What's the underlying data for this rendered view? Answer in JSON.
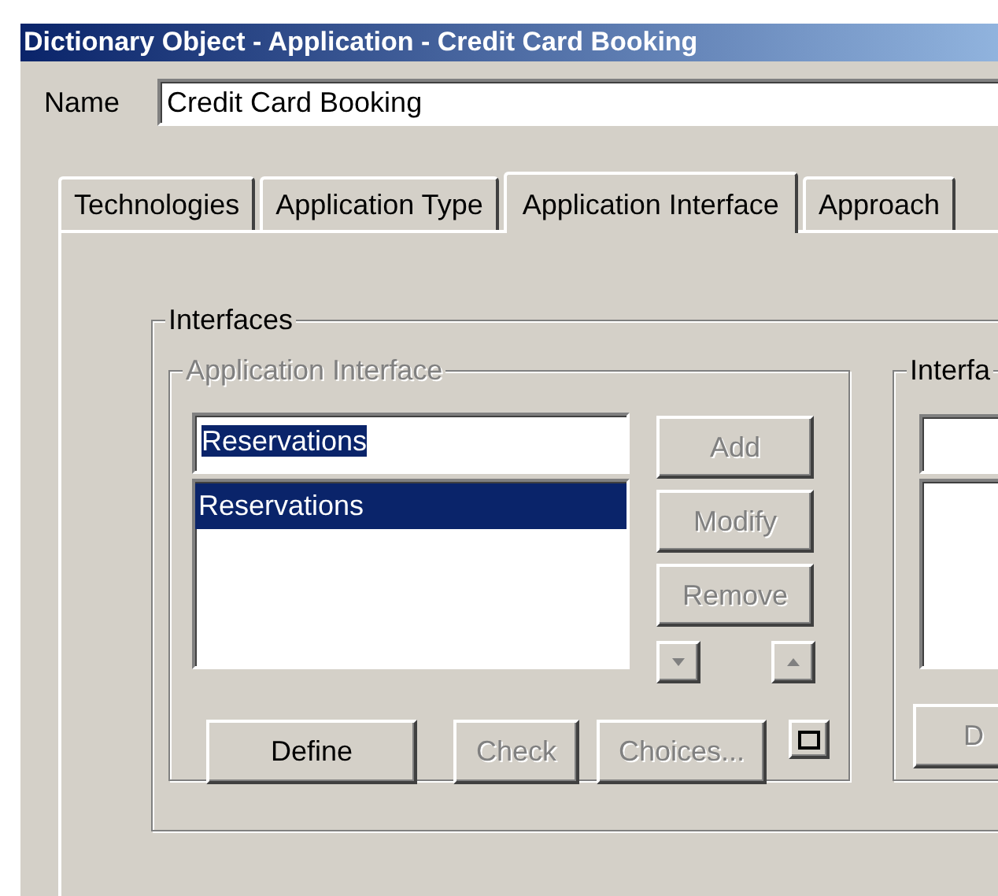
{
  "window": {
    "title": "Dictionary Object - Application - Credit Card Booking"
  },
  "name_field": {
    "label": "Name",
    "value": "Credit Card Booking"
  },
  "tabs": [
    {
      "label": "Technologies",
      "selected": false
    },
    {
      "label": "Application Type",
      "selected": false
    },
    {
      "label": "Application Interface",
      "selected": true
    },
    {
      "label": "Approach",
      "selected": false
    }
  ],
  "interfaces": {
    "title": "Interfaces",
    "application_interface": {
      "title": "Application Interface",
      "disabled": true,
      "input": {
        "value": "Reservations",
        "text_selected": true
      },
      "list": [
        {
          "label": "Reservations",
          "selected": true
        }
      ],
      "side_buttons": [
        {
          "label": "Add",
          "disabled": true
        },
        {
          "label": "Modify",
          "disabled": true
        },
        {
          "label": "Remove",
          "disabled": true
        }
      ],
      "arrows": [
        {
          "kind": "down",
          "disabled": true
        },
        {
          "kind": "up",
          "disabled": true
        }
      ],
      "bottom_buttons": [
        {
          "label": "Define",
          "disabled": false
        },
        {
          "label": "Check",
          "disabled": true
        },
        {
          "label": "Choices...",
          "disabled": true
        }
      ]
    },
    "interface_panel": {
      "title": "Interfa",
      "button": {
        "label": "D",
        "disabled": true
      }
    }
  }
}
